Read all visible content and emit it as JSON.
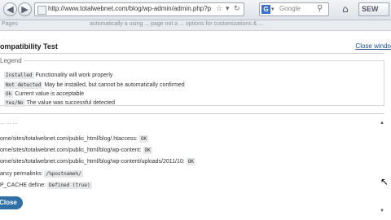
{
  "browser": {
    "url": "http://www.totalwebnet.com/blog/wp-admin/admin.php?page=wbc_gene",
    "search_engine": "G",
    "search_placeholder": "Google",
    "profile_button": "SEW",
    "icons": {
      "back": "back-arrow-icon",
      "forward": "forward-arrow-icon",
      "home": "home-icon",
      "search": "magnifier-icon",
      "reload": "reload-icon",
      "star": "star-icon"
    }
  },
  "background_page": {
    "strip_text_left": "Pages",
    "strip_text_mid": "automatically a using ... page not a ... options for customizations & ..."
  },
  "modal": {
    "title": "ompatibility Test",
    "close_window": "Close windo",
    "legend_title": "Legend",
    "legend_items": [
      {
        "code": "Installed",
        "text": "Functionality will work properly"
      },
      {
        "code": "Not detected",
        "text": "May be installed, but cannot be automatically confirmed"
      },
      {
        "code": "Ok",
        "text": "Current value is acceptable"
      },
      {
        "code": "Yes/No",
        "text": "The value was successful detected"
      }
    ],
    "section_heading": "... ... ...",
    "checks": [
      {
        "label": "ome/sites/totalwebnet.com/public_html/blog/.htaccess:",
        "status": "OK"
      },
      {
        "label": "ome/sites/totalwebnet.com/public_html/blog/wp-content:",
        "status": "OK"
      },
      {
        "label": "ome/sites/totalwebnet.com/public_html/blog/wp-content/uploads/2011/10:",
        "status": "OK"
      },
      {
        "label": "ancy permalinks:",
        "status": "/%postname%/"
      },
      {
        "label": "P_CACHE define:",
        "status": "Defined (true)"
      }
    ],
    "close_button": "Close"
  },
  "colors": {
    "accent": "#2f6fa7",
    "link": "#1a4e8a"
  }
}
